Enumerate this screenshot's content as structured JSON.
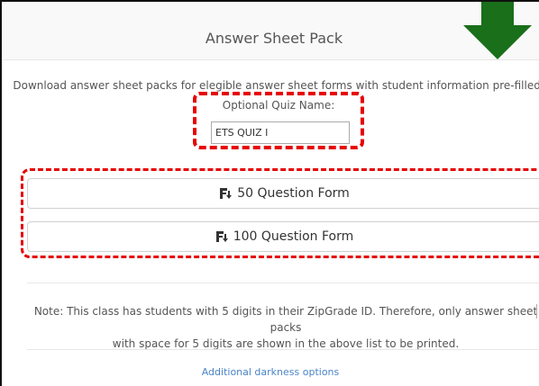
{
  "panel": {
    "title": "Answer Sheet Pack"
  },
  "description": "Download answer sheet packs for elegible answer sheet forms with student information pre-filled.",
  "quiz_name": {
    "label": "Optional Quiz Name:",
    "value": "ETS QUIZ I"
  },
  "forms": [
    {
      "label": "50 Question Form",
      "icon": "form-download-icon"
    },
    {
      "label": "100 Question Form",
      "icon": "form-download-icon"
    }
  ],
  "note": {
    "line1": "Note: This class has students with 5 digits in their ZipGrade ID. Therefore, only answer sheet packs",
    "line2": "with space for 5 digits are shown in the above list to be printed."
  },
  "additional_link": "Additional darkness options",
  "colors": {
    "annotation_red": "#e60000",
    "arrow_green": "#1a6f1a",
    "link_blue": "#4a86c5"
  }
}
